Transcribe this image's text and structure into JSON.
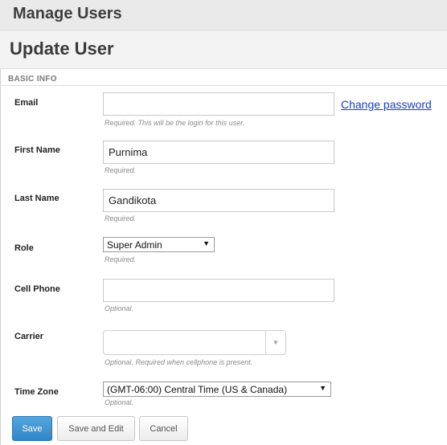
{
  "header": {
    "title": "Manage Users"
  },
  "subheader": {
    "title": "Update User"
  },
  "section": {
    "label": "BASIC INFO"
  },
  "fields": {
    "email": {
      "label": "Email",
      "value": "",
      "hint": "Required. This will be the login for this user.",
      "link": "Change password"
    },
    "first_name": {
      "label": "First Name",
      "value": "Purnima",
      "hint": "Required."
    },
    "last_name": {
      "label": "Last Name",
      "value": "Gandikota",
      "hint": "Required."
    },
    "role": {
      "label": "Role",
      "selected": "Super Admin",
      "hint": "Required."
    },
    "cell_phone": {
      "label": "Cell Phone",
      "value": "",
      "hint": "Optional."
    },
    "carrier": {
      "label": "Carrier",
      "selected": "",
      "hint": "Optional. Required when cellphone is present."
    },
    "time_zone": {
      "label": "Time Zone",
      "selected": "(GMT-06:00) Central Time (US & Canada)",
      "hint": "Optional."
    }
  },
  "actions": {
    "save": "Save",
    "save_and_edit": "Save and Edit",
    "cancel": "Cancel"
  },
  "icons": {
    "dropdown_arrow": "caret-down-icon"
  },
  "colors": {
    "primary_button": "#3a90d0",
    "link": "#1a3fbf"
  }
}
